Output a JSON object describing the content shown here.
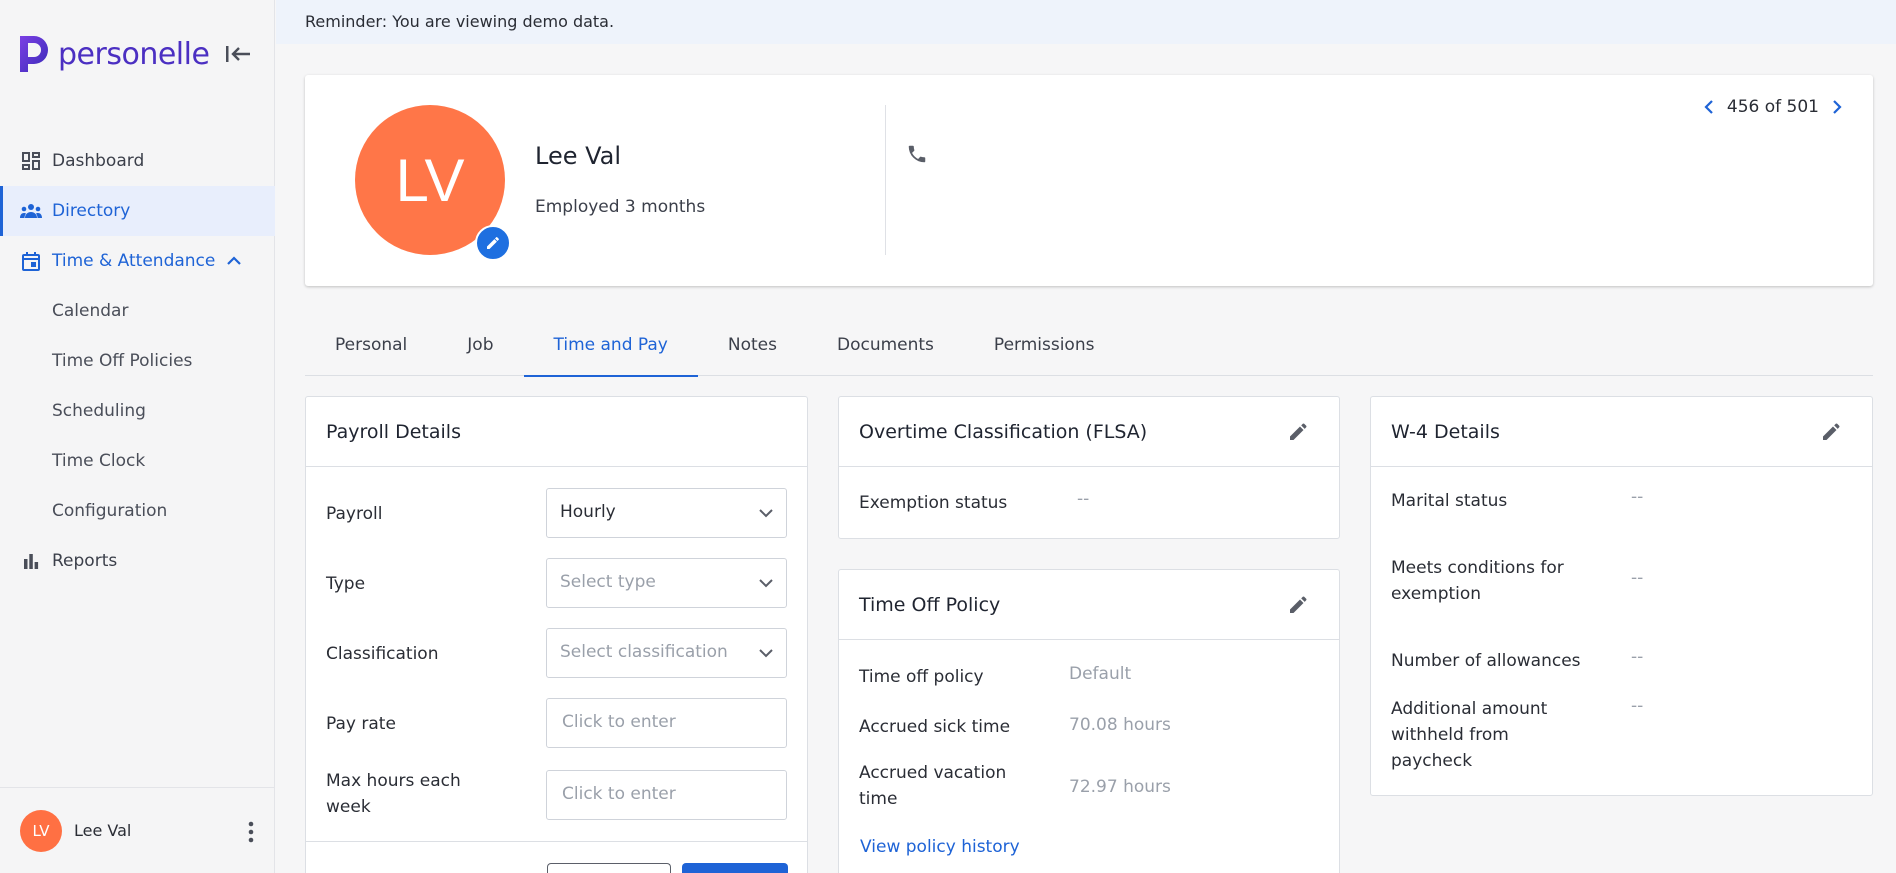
{
  "app": {
    "brand": "personelle"
  },
  "sidebar": {
    "items": [
      {
        "label": "Dashboard",
        "icon": "dashboard-icon"
      },
      {
        "label": "Directory",
        "icon": "people-icon"
      },
      {
        "label": "Time & Attendance",
        "icon": "calendar-icon"
      },
      {
        "label": "Reports",
        "icon": "bar-chart-icon"
      }
    ],
    "sub_items": [
      "Calendar",
      "Time Off Policies",
      "Scheduling",
      "Time Clock",
      "Configuration"
    ],
    "user": {
      "initials": "LV",
      "name": "Lee Val"
    }
  },
  "banner": {
    "text": "Reminder: You are viewing demo data."
  },
  "profile": {
    "initials": "LV",
    "name": "Lee Val",
    "tenure": "Employed 3 months",
    "pager": "456 of 501"
  },
  "tabs": [
    "Personal",
    "Job",
    "Time and Pay",
    "Notes",
    "Documents",
    "Permissions"
  ],
  "payroll": {
    "title": "Payroll Details",
    "rows": [
      {
        "label": "Payroll",
        "value": "Hourly"
      },
      {
        "label": "Type",
        "placeholder": "Select type"
      },
      {
        "label": "Classification",
        "placeholder": "Select classification"
      },
      {
        "label": "Pay rate",
        "placeholder": "Click to enter"
      },
      {
        "label": "Max hours each week",
        "placeholder": "Click to enter"
      }
    ]
  },
  "overtime": {
    "title": "Overtime Classification (FLSA)",
    "label": "Exemption status",
    "value": "--"
  },
  "timeoff": {
    "title": "Time Off Policy",
    "rows": [
      {
        "label": "Time off policy",
        "value": "Default"
      },
      {
        "label": "Accrued sick time",
        "value": "70.08 hours"
      },
      {
        "label": "Accrued vacation time",
        "value": "72.97 hours"
      }
    ],
    "link": "View policy history"
  },
  "w4": {
    "title": "W-4 Details",
    "rows": [
      {
        "label": "Marital status",
        "value": "--"
      },
      {
        "label": "Meets conditions for exemption",
        "value": "--"
      },
      {
        "label": "Number of allowances",
        "value": "--"
      },
      {
        "label": "Additional amount withheld from paycheck",
        "value": "--"
      }
    ]
  },
  "colors": {
    "accent": "#1e63d6",
    "brand": "#4b2fc2",
    "avatar": "#ff7648"
  }
}
